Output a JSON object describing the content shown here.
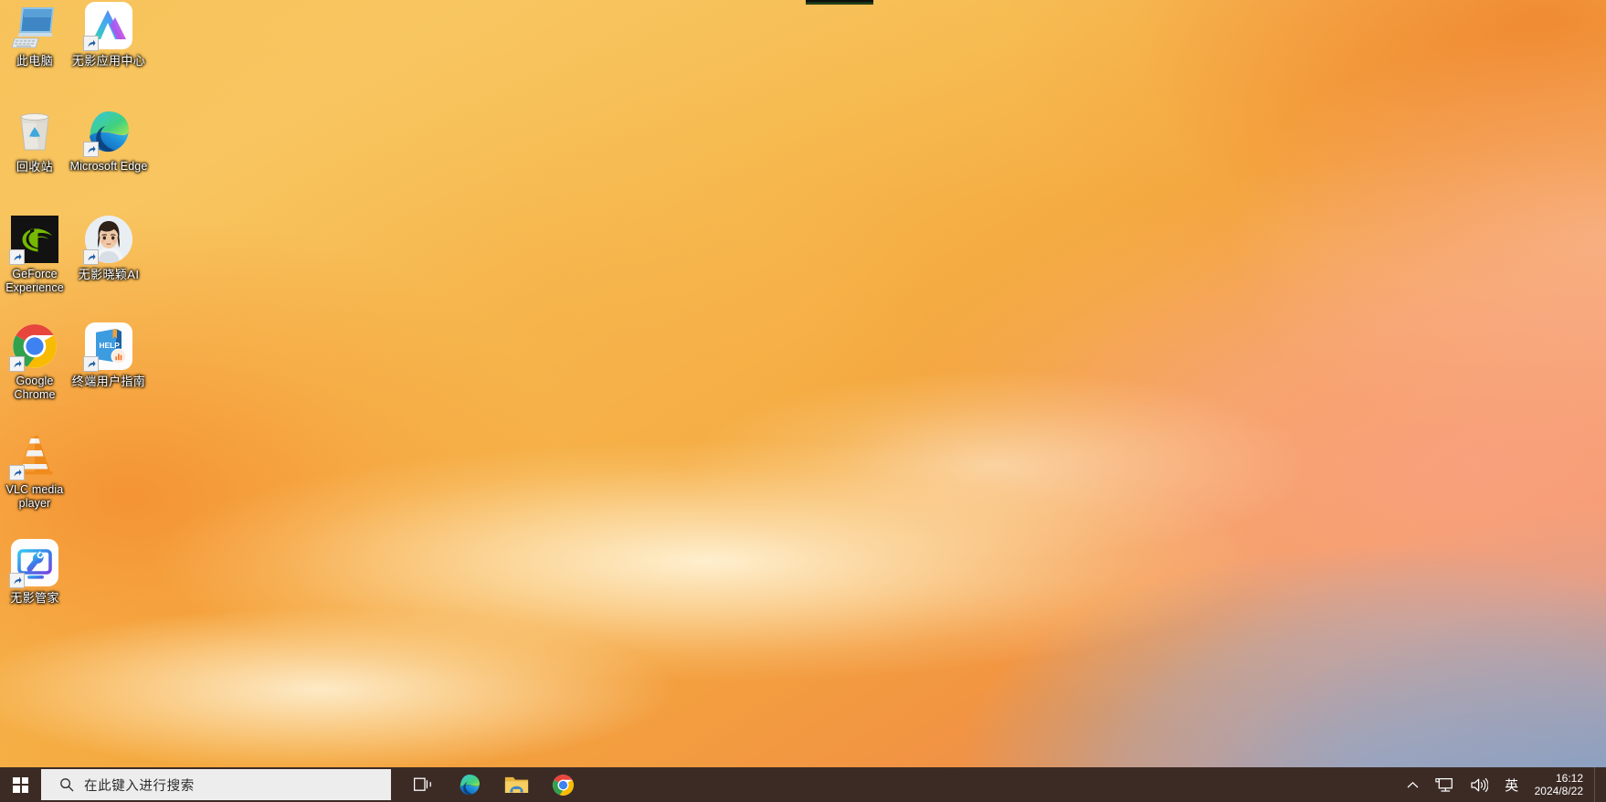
{
  "desktop": {
    "icons": [
      {
        "id": "this-pc",
        "label": "此电脑",
        "icon": "computer-icon",
        "shortcut": false
      },
      {
        "id": "wuying-app-center",
        "label": "无影应用中心",
        "icon": "wuying-app-center-icon",
        "shortcut": true
      },
      {
        "id": "recycle-bin",
        "label": "回收站",
        "icon": "recycle-bin-icon",
        "shortcut": false
      },
      {
        "id": "microsoft-edge",
        "label": "Microsoft Edge",
        "icon": "edge-icon",
        "shortcut": true
      },
      {
        "id": "geforce-experience",
        "label": "GeForce Experience",
        "icon": "nvidia-icon",
        "shortcut": true
      },
      {
        "id": "wuying-xiaoying-ai",
        "label": "无影晓颖AI",
        "icon": "avatar-icon",
        "shortcut": true
      },
      {
        "id": "google-chrome",
        "label": "Google Chrome",
        "icon": "chrome-icon",
        "shortcut": true
      },
      {
        "id": "user-guide",
        "label": "终端用户指南",
        "icon": "help-book-icon",
        "shortcut": true
      },
      {
        "id": "vlc-media-player",
        "label": "VLC media player",
        "icon": "vlc-cone-icon",
        "shortcut": true
      },
      {
        "id": "wuying-manager",
        "label": "无影管家",
        "icon": "wuying-manager-icon",
        "shortcut": true
      }
    ]
  },
  "taskbar": {
    "start_label": "开始",
    "search": {
      "placeholder": "在此键入进行搜索",
      "value": ""
    },
    "apps": [
      {
        "id": "task-view",
        "label": "任务视图",
        "icon": "task-view-icon"
      },
      {
        "id": "edge",
        "label": "Microsoft Edge",
        "icon": "edge-icon"
      },
      {
        "id": "file-explorer",
        "label": "文件资源管理器",
        "icon": "folder-icon"
      },
      {
        "id": "chrome",
        "label": "Google Chrome",
        "icon": "chrome-icon"
      }
    ],
    "tray": {
      "overflow_label": "显示隐藏的图标",
      "network_label": "网络",
      "volume_label": "音量",
      "ime_label": "英"
    },
    "clock": {
      "time": "16:12",
      "date": "2024/8/22"
    }
  },
  "colors": {
    "taskbar_bg": "#3C2B25",
    "search_bg": "#EDEDED",
    "wallpaper_gold": "#F7C158",
    "wallpaper_orange": "#ED7422",
    "wallpaper_blue": "#7A9CC7",
    "wallpaper_salmon": "#FAA386",
    "text_on_dark": "#FFFFFF"
  }
}
